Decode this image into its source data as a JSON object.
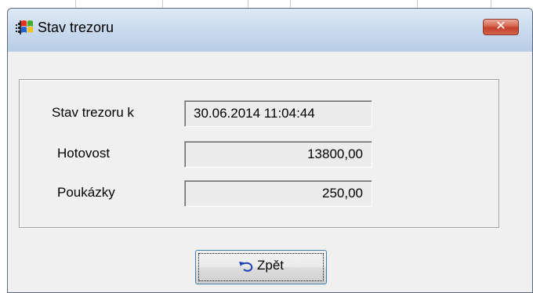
{
  "window": {
    "title": "Stav trezoru",
    "icon": "app-windows-flag-icon",
    "close_symbol": "✕"
  },
  "form": {
    "rows": [
      {
        "label": "Stav trezoru k",
        "value": "30.06.2014 11:04:44"
      },
      {
        "label": "Hotovost",
        "value": "13800,00"
      },
      {
        "label": "Poukázky",
        "value": "250,00"
      }
    ]
  },
  "buttons": {
    "back_label": "Zpět",
    "back_icon": "undo-arrow-icon"
  },
  "colors": {
    "titlebar": "#c9daee",
    "close_button": "#d5634a",
    "dialog_background": "#f0f0f0",
    "field_background": "#ececec",
    "button_focus_border": "#3c7fb1"
  }
}
